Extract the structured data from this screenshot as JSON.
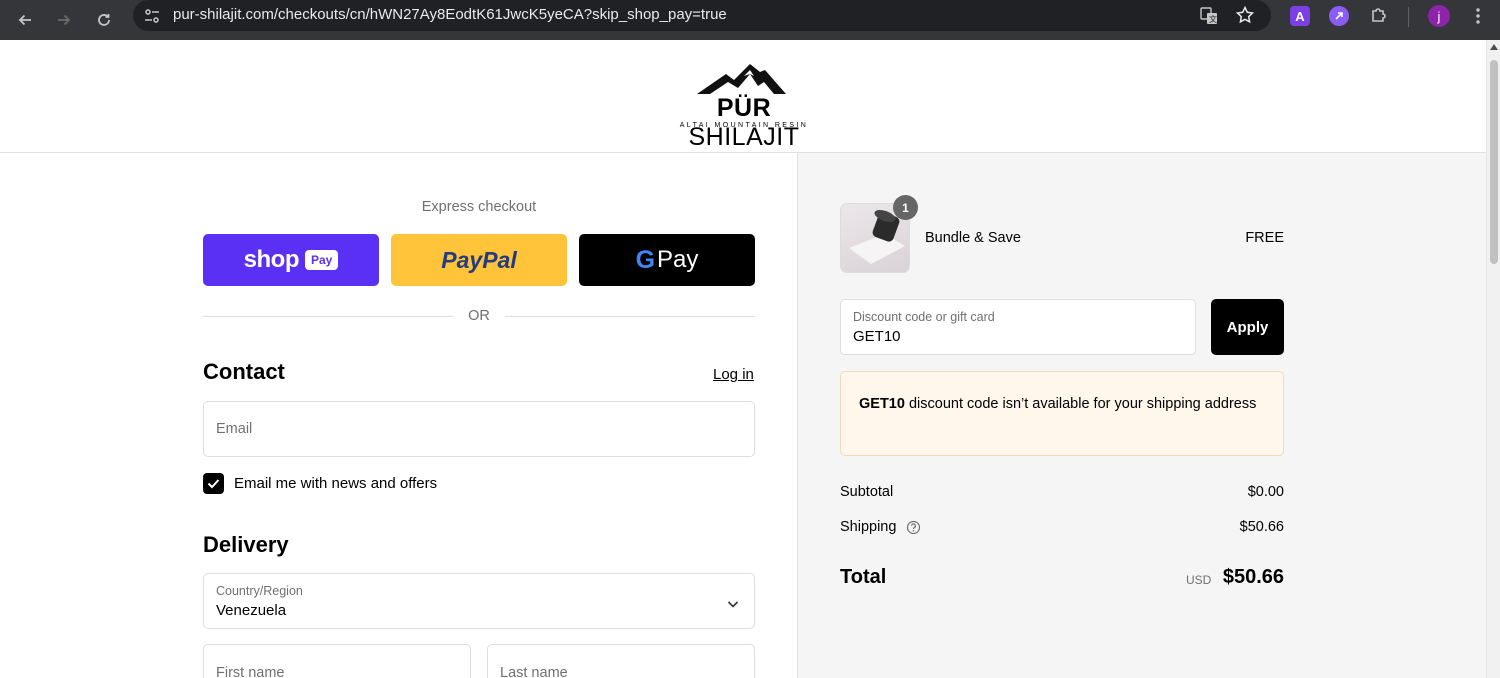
{
  "browser": {
    "url": "pur-shilajit.com/checkouts/cn/hWN27Ay8EodtK61JwcK5yeCA?skip_shop_pay=true",
    "profile_initial": "j",
    "ext_a_label": "A"
  },
  "header": {
    "logo_main": "PÜR",
    "logo_second": "SHILAJIT",
    "logo_sub": "ALTAI MOUNTAIN RESIN"
  },
  "checkout": {
    "express_label": "Express checkout",
    "shop_pay_brand": "shop",
    "shop_pay_badge": "Pay",
    "paypal_label": "PayPal",
    "gpay_label": "Pay",
    "or_label": "OR",
    "contact_title": "Contact",
    "login_label": "Log in",
    "email_placeholder": "Email",
    "newsletter_label": "Email me with news and offers",
    "newsletter_checked": true,
    "delivery_title": "Delivery",
    "country_label": "Country/Region",
    "country_value": "Venezuela",
    "first_name_placeholder": "First name",
    "last_name_placeholder": "Last name"
  },
  "summary": {
    "product": {
      "name": "Bundle & Save",
      "price": "FREE",
      "quantity": "1"
    },
    "discount": {
      "label": "Discount code or gift card",
      "value": "GET10",
      "apply_label": "Apply"
    },
    "notice": {
      "code": "GET10",
      "message": " discount code isn’t available for your shipping address"
    },
    "subtotal_label": "Subtotal",
    "subtotal_value": "$0.00",
    "shipping_label": "Shipping",
    "shipping_value": "$50.66",
    "total_label": "Total",
    "currency": "USD",
    "total_value": "$50.66"
  },
  "colors": {
    "shop_pay": "#5a31f4",
    "paypal": "#ffc439",
    "gpay": "#000000",
    "notice_bg": "#fff6ec"
  }
}
